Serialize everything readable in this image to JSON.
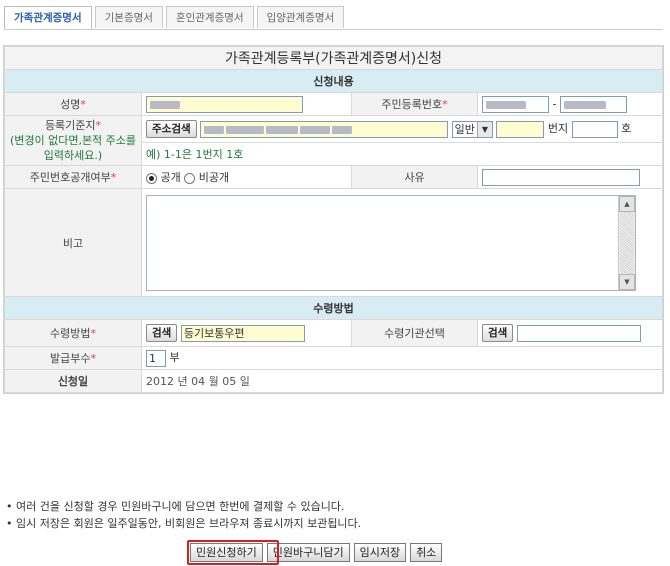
{
  "tabs": [
    {
      "label": "가족관계증명서",
      "active": true
    },
    {
      "label": "기본증명서",
      "active": false
    },
    {
      "label": "혼인관계증명서",
      "active": false
    },
    {
      "label": "입양관계증명서",
      "active": false
    }
  ],
  "form": {
    "title": "가족관계등록부(가족관계증명서)신청",
    "section_apply": "신청내용",
    "name_label": "성명",
    "req_mark": "*",
    "rrn_label": "주민등록번호",
    "rrn_sep": "-",
    "address_label": "등록기준지",
    "address_hint": "(변경이 없다면,본적 주소를 입력하세요.)",
    "address_search_btn": "주소검색",
    "address_type": "일반",
    "bunji_label": "번지",
    "ho_label": "호",
    "address_example": "예) 1-1은 1번지 1호",
    "rrn_disclose_label": "주민번호공개여부",
    "disclose_public": "공개",
    "disclose_private": "비공개",
    "reason_label": "사유",
    "remark_label": "비고",
    "section_receive": "수령방법",
    "receive_method_label": "수령방법",
    "search_btn": "검색",
    "receive_method_value": "등기보통우편",
    "receive_org_label": "수령기관선택",
    "copies_label": "발급부수",
    "copies_value": "1",
    "copies_unit": "부",
    "apply_date_label": "신청일",
    "apply_date_value": "2012  년 04  월 05  일"
  },
  "notes": [
    "• 여러 건을 신청할 경우 민원바구니에 담으면 한번에 결제할 수 있습니다.",
    "• 임시 저장은 회원은 일주일동안, 비회원은 브라우져 종료시까지 보관됩니다."
  ],
  "actions": {
    "apply": "민원신청하기",
    "basket": "민원바구니담기",
    "temp_save": "임시저장",
    "cancel": "취소"
  },
  "colors": {
    "section_bg": "#d8ecf4",
    "required": "#e03c3c",
    "highlight": "#e01b1b",
    "input_yellow": "#fffcd2"
  }
}
